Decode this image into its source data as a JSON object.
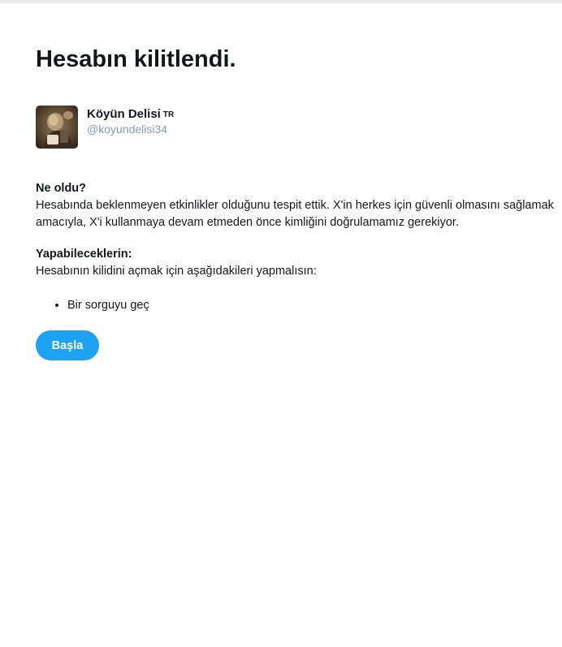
{
  "page": {
    "title": "Hesabın kilitlendi."
  },
  "user": {
    "display_name": "Köyün Delisi",
    "country_badge": "TR",
    "handle": "@koyundelisi34"
  },
  "what_happened": {
    "title": "Ne oldu?",
    "text": "Hesabında beklenmeyen etkinlikler olduğunu tespit ettik. X'in herkes için güvenli olmasını sağlamak amacıyla, X'i kullanmaya devam etmeden önce kimliğini doğrulamamız gerekiyor."
  },
  "what_you_can_do": {
    "title": "Yapabileceklerin:",
    "text": "Hesabının kilidini açmak için aşağıdakileri yapmalısın:",
    "steps": [
      "Bir sorguyu geç"
    ]
  },
  "actions": {
    "start_label": "Başla"
  },
  "colors": {
    "accent": "#1da1f2",
    "text": "#14171a",
    "muted": "#8a9aa8"
  }
}
